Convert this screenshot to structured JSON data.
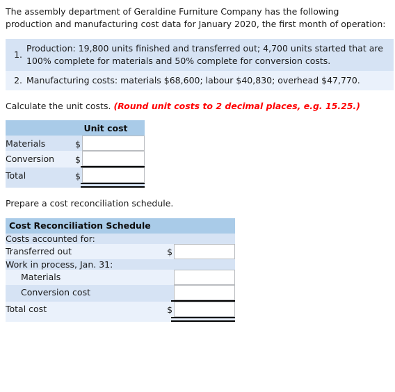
{
  "intro": {
    "paragraph": "The assembly department of Geraldine Furniture Company has the following production and manufacturing cost data for January 2020, the first month of operation:"
  },
  "facts": [
    {
      "number": "1.",
      "text": "Production: 19,800 units finished and transferred out; 4,700 units started that are 100% complete for materials and 50% complete for conversion costs."
    },
    {
      "number": "2.",
      "text": "Manufacturing costs: materials $68,600; labour $40,830; overhead $47,770."
    }
  ],
  "instructions": {
    "unit_costs": "Calculate the unit costs.",
    "unit_costs_note": "(Round unit costs to 2 decimal places, e.g. 15.25.)",
    "reconciliation": "Prepare a cost reconciliation schedule."
  },
  "unit_cost_table": {
    "header": "Unit cost",
    "rows": [
      {
        "label": "Materials",
        "currency": "$",
        "value": "",
        "placeholder": ""
      },
      {
        "label": "Conversion",
        "currency": "$",
        "value": "",
        "placeholder": ""
      },
      {
        "label": "Total",
        "currency": "$",
        "value": "",
        "placeholder": ""
      }
    ]
  },
  "reconciliation_table": {
    "header": "Cost Reconciliation Schedule",
    "section_label": "Costs accounted for:",
    "wip_label": "Work in process, Jan. 31:",
    "rows": [
      {
        "label": "Transferred out",
        "currency": "$",
        "value": "",
        "placeholder": ""
      },
      {
        "label": "Materials",
        "currency": "",
        "value": "",
        "placeholder": ""
      },
      {
        "label": "Conversion cost",
        "currency": "",
        "value": "",
        "placeholder": ""
      },
      {
        "label": "Total cost",
        "currency": "$",
        "value": "",
        "placeholder": ""
      }
    ]
  },
  "colors": {
    "header_band": "#a9cbe8",
    "row_shade_dark": "#d6e3f4",
    "row_shade_light": "#eaf1fb",
    "note_red": "#ff0000",
    "input_border": "#b9bcc0",
    "rule_black": "#000000"
  }
}
